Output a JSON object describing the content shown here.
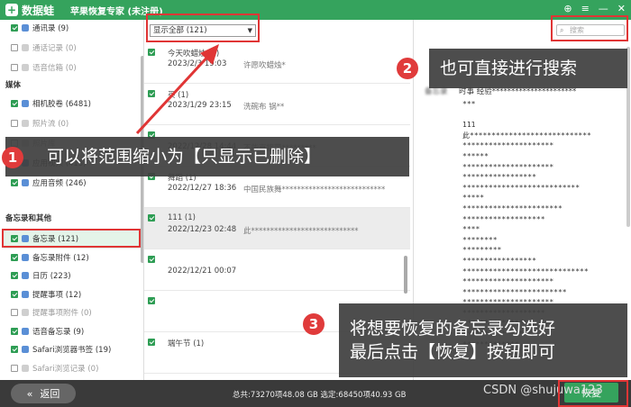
{
  "app": {
    "name": "数据蛙",
    "title": "苹果恢复专家 (未注册)"
  },
  "sidebar": {
    "items_top": [
      {
        "label": "通讯录 (9)",
        "checked": true
      },
      {
        "label": "通话记录 (0)",
        "checked": false,
        "dim": true
      },
      {
        "label": "语音信箱 (0)",
        "checked": false,
        "dim": true
      }
    ],
    "section_media": "媒体",
    "items_media": [
      {
        "label": "相机胶卷 (6481)",
        "checked": true
      },
      {
        "label": "照片流 (0)",
        "checked": false,
        "dim": true
      },
      {
        "label": "照片库",
        "checked": false,
        "dim": true
      },
      {
        "label": "应用视频 (415)",
        "checked": true
      },
      {
        "label": "应用音频 (246)",
        "checked": true
      }
    ],
    "section_memo": "备忘录和其他",
    "items_memo": [
      {
        "label": "备忘录 (121)",
        "checked": true
      },
      {
        "label": "备忘录附件 (12)",
        "checked": true
      },
      {
        "label": "日历 (223)",
        "checked": true
      },
      {
        "label": "提醒事项 (12)",
        "checked": true
      },
      {
        "label": "提醒事项附件 (0)",
        "checked": false,
        "dim": true
      },
      {
        "label": "语音备忘录 (9)",
        "checked": true
      },
      {
        "label": "Safari浏览器书签 (19)",
        "checked": true
      },
      {
        "label": "Safari浏览记录 (0)",
        "checked": false,
        "dim": true
      }
    ]
  },
  "list": {
    "filter": "显示全部 (121)",
    "rows": [
      {
        "t1": "今天吹蜡烛 (1)",
        "t2": "2023/2/3 19:03",
        "t3": "许愿吹蜡烛*"
      },
      {
        "t1": "买 (1)",
        "t2": "2023/1/29 23:15",
        "t3": "洗碗布 锅**"
      },
      {
        "t1": "",
        "t2": "2022/12/28 14:44",
        "t3": "不能直接带*********"
      },
      {
        "t1": "舞蹈 (1)",
        "t2": "2022/12/27 18:36",
        "t3": "中国民族舞***************************"
      },
      {
        "t1": "111 (1)",
        "t2": "2022/12/23 02:48",
        "t3": "此****************************"
      },
      {
        "t1": "",
        "t2": "2022/12/21 00:07",
        "t3": ""
      },
      {
        "t1": "",
        "t2": "",
        "t3": ""
      },
      {
        "t1": "端午节 (1)",
        "t2": "",
        "t3": ""
      }
    ]
  },
  "detail": {
    "search_placeholder": "搜索",
    "header_label": "备忘录",
    "header_value": "时事   经验**********************",
    "body": "***\n\n111\n此****************************\n*********************\n******\n*********************\n*****************\n***************************\n*****\n***********************\n*******************\n****\n********\n*********\n*****************\n*****************************\n*********************\n************************\n*********************\n*******************\n****************\n*****************\n*************"
  },
  "footer": {
    "back": "返回",
    "summary": "总共:73270项48.08 GB 选定:68450项40.93 GB",
    "watermark": "CSDN @shujuwa123",
    "recover": "恢复"
  },
  "callouts": [
    {
      "num": "1",
      "text": "可以将范围缩小为【只显示已删除】"
    },
    {
      "num": "2",
      "text": "也可直接进行搜索"
    },
    {
      "num": "3",
      "line1": "将想要恢复的备忘录勾选好",
      "line2": "最后点击【恢复】按钮即可"
    }
  ]
}
